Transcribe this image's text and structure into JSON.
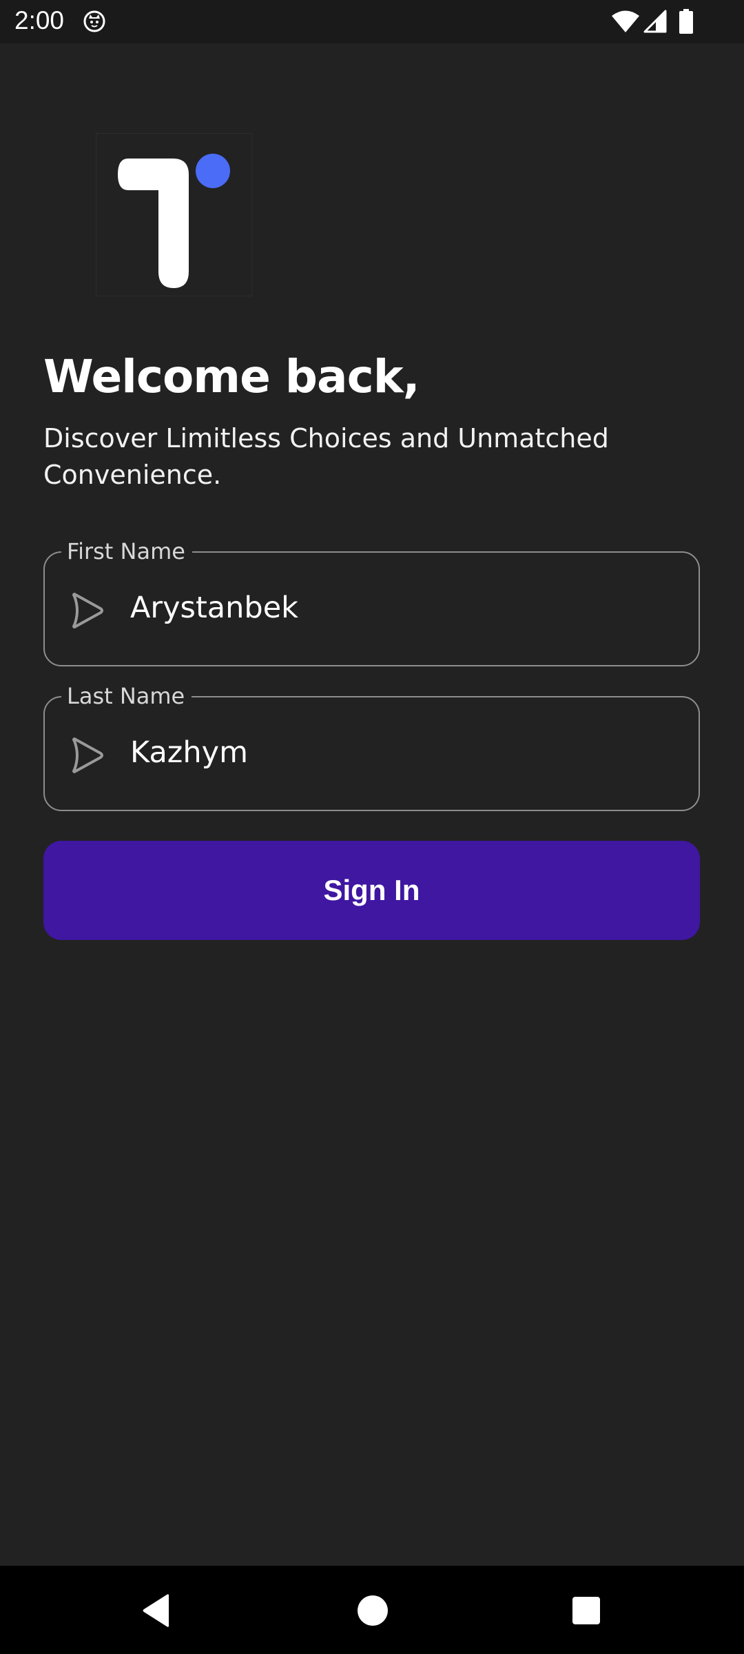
{
  "status_bar": {
    "time": "2:00",
    "icons": [
      "cat-notification-icon",
      "wifi-icon",
      "cell-signal-icon",
      "battery-icon"
    ]
  },
  "logo": {
    "icon": "app-logo",
    "colors": {
      "letter": "#ffffff",
      "dot": "#4a6cf7"
    }
  },
  "welcome": {
    "title": "Welcome back,",
    "subtitle": "Discover Limitless Choices and Unmatched Convenience."
  },
  "form": {
    "first_name": {
      "label": "First Name",
      "value": "Arystanbek",
      "icon": "send-arrow-icon"
    },
    "last_name": {
      "label": "Last Name",
      "value": "Kazhym",
      "icon": "send-arrow-icon"
    },
    "submit_label": "Sign In"
  },
  "nav_bar": {
    "icons": [
      "back-icon",
      "home-icon",
      "recents-icon"
    ]
  },
  "colors": {
    "background": "#222222",
    "accent": "#3f17a1",
    "field_border": "#8e8e8e"
  }
}
